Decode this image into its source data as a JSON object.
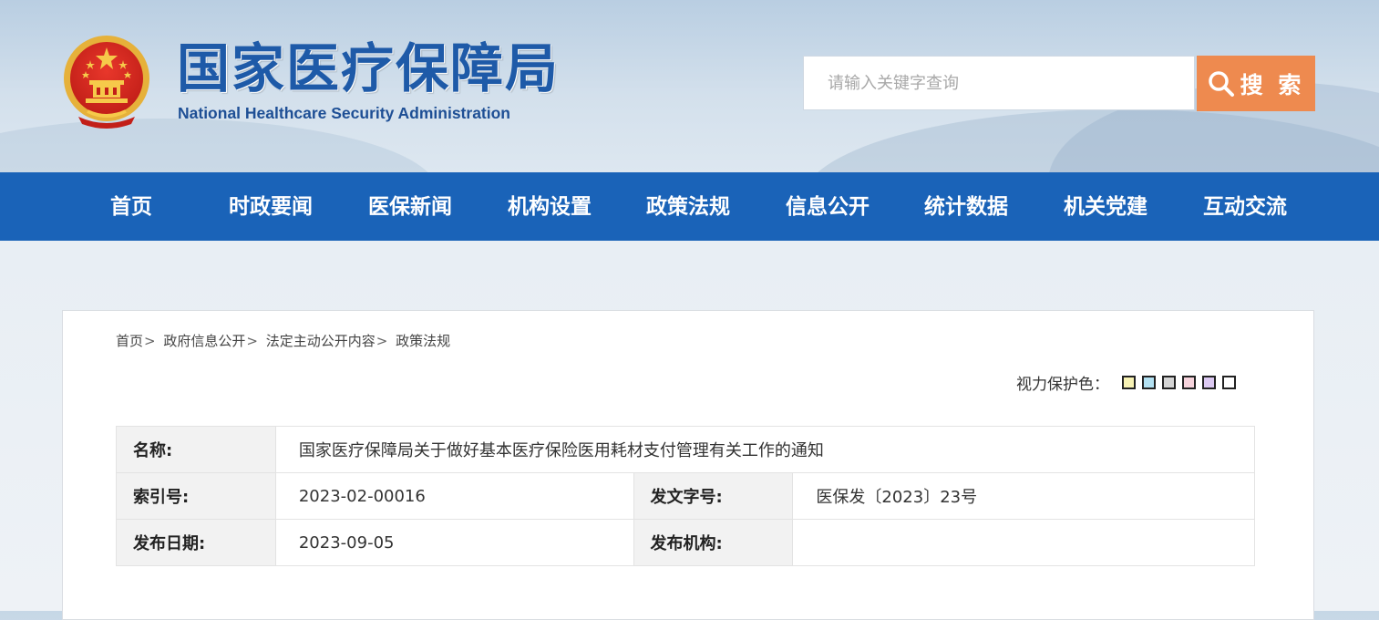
{
  "header": {
    "title_cn": "国家医疗保障局",
    "title_en": "National Healthcare Security Administration",
    "search_placeholder": "请输入关键字查询",
    "search_button": "搜 索"
  },
  "nav": {
    "items": [
      "首页",
      "时政要闻",
      "医保新闻",
      "机构设置",
      "政策法规",
      "信息公开",
      "统计数据",
      "机关党建",
      "互动交流"
    ]
  },
  "breadcrumb": [
    "首页",
    "政府信息公开",
    "法定主动公开内容",
    "政策法规"
  ],
  "eye_care": {
    "label": "视力保护色：",
    "colors": [
      "#f7f2b4",
      "#b3e1f2",
      "#d5d5d5",
      "#f6d3dc",
      "#dcc9f2",
      "#ffffff"
    ]
  },
  "meta": {
    "name_label": "名称:",
    "name_value": "国家医疗保障局关于做好基本医疗保险医用耗材支付管理有关工作的通知",
    "index_label": "索引号:",
    "index_value": "2023-02-00016",
    "doc_no_label": "发文字号:",
    "doc_no_value": "医保发〔2023〕23号",
    "date_label": "发布日期:",
    "date_value": "2023-09-05",
    "org_label": "发布机构:",
    "org_value": ""
  },
  "colors": {
    "nav_blue": "#1a63b8",
    "search_orange": "#ee8a4f",
    "title_blue": "#1e5aa8"
  }
}
